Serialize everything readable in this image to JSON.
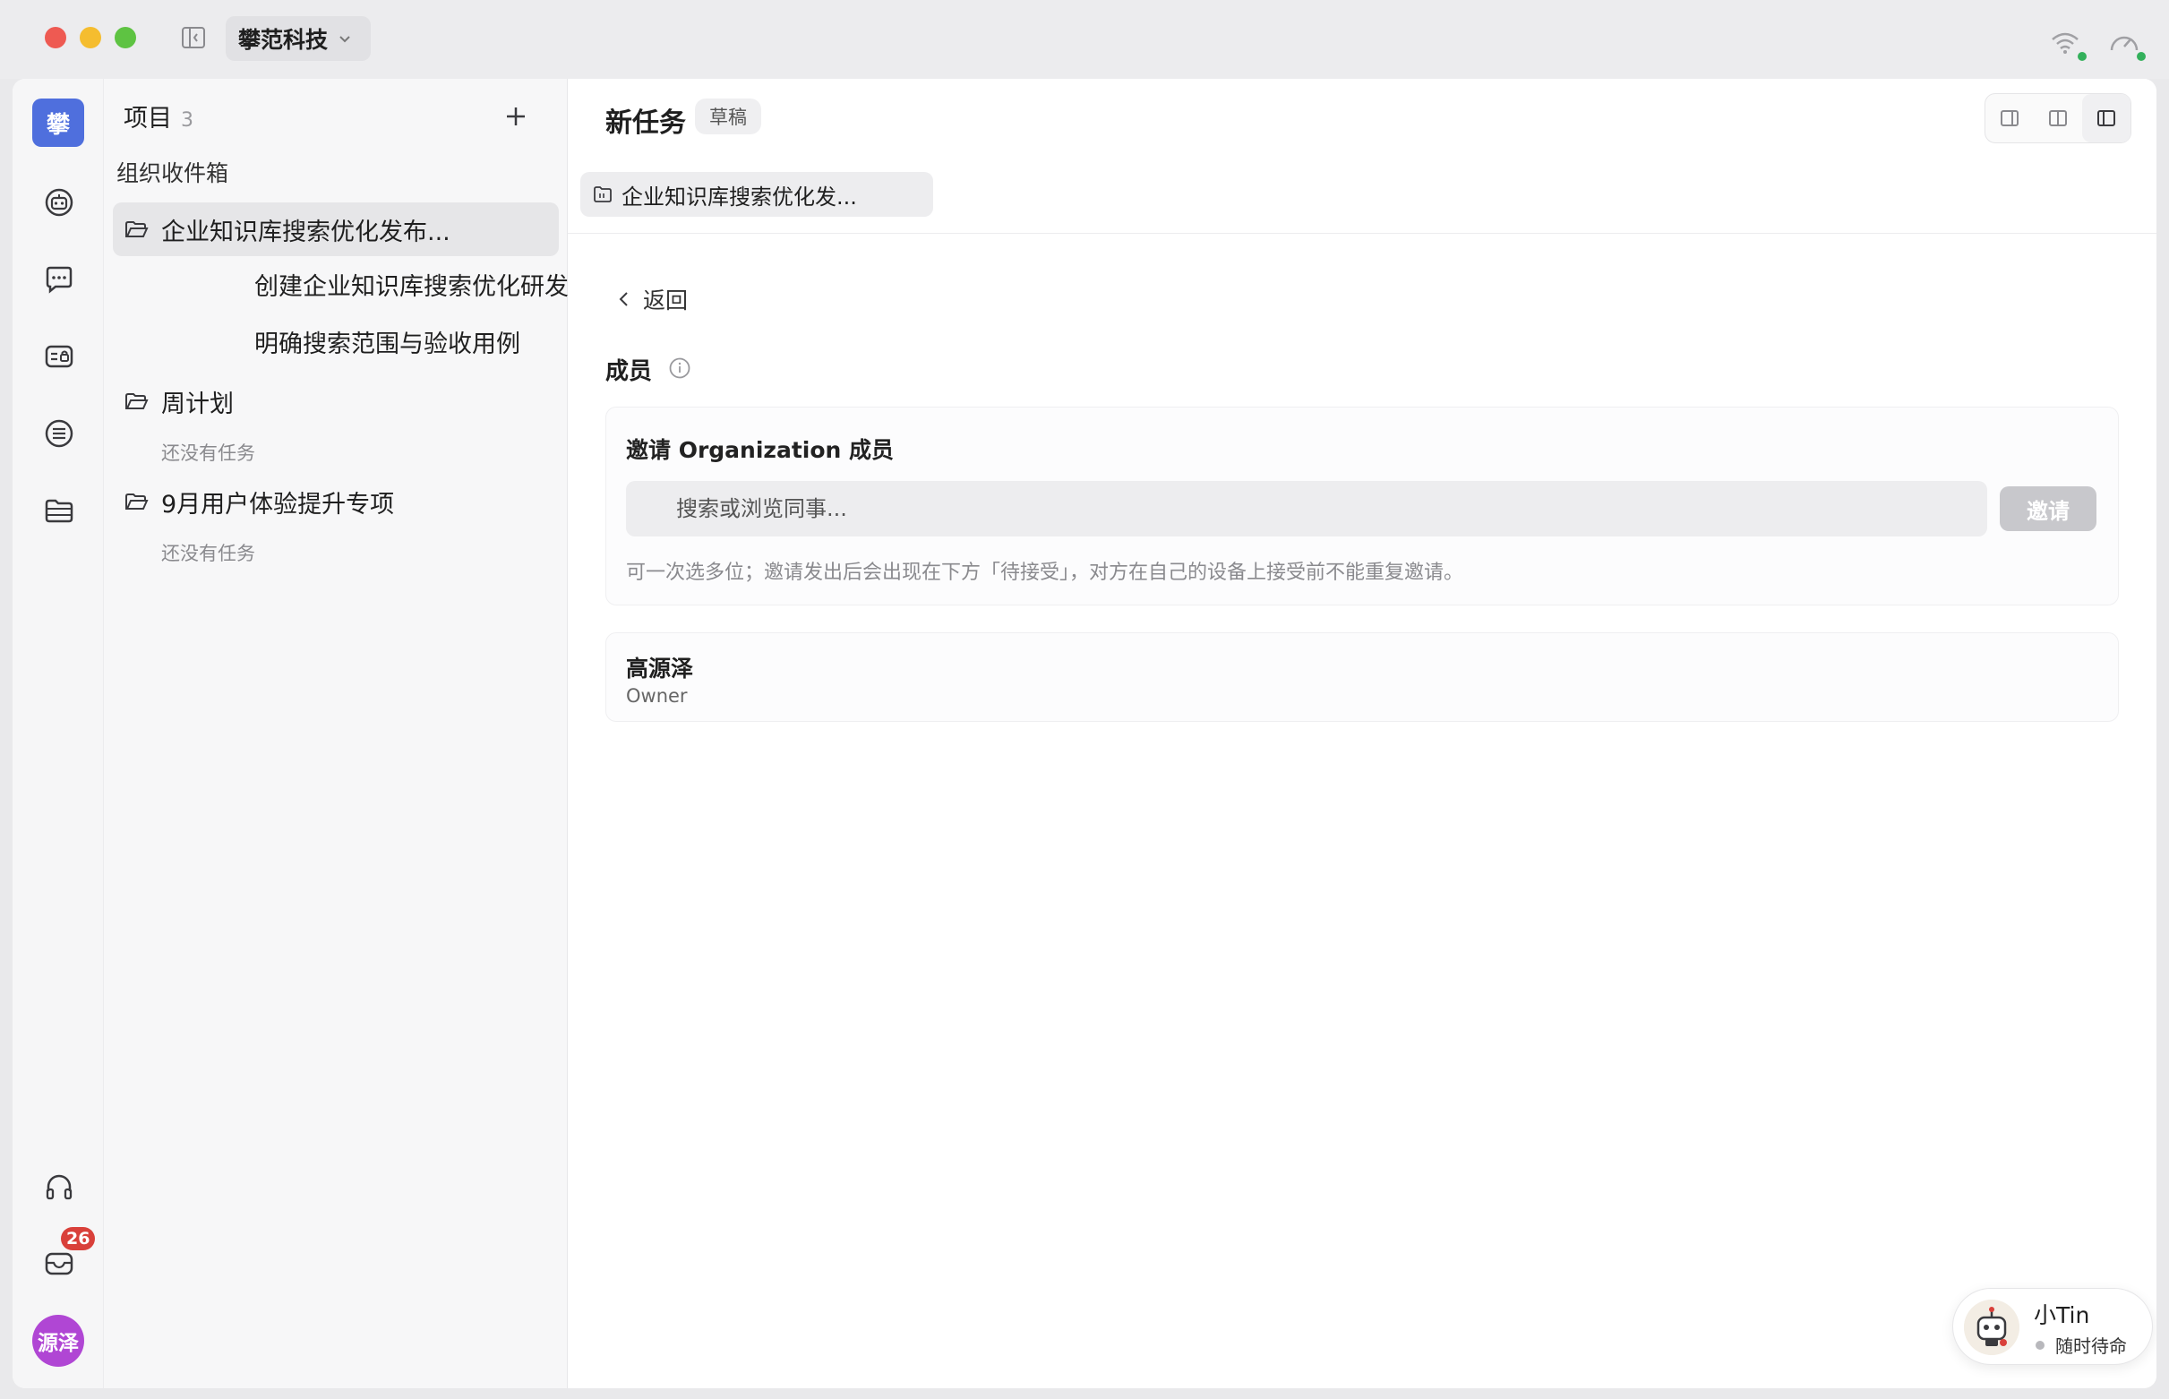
{
  "titlebar": {
    "org_name": "攀范科技"
  },
  "rail": {
    "logo_text": "攀",
    "items": [
      {
        "name": "robot-icon"
      },
      {
        "name": "chat-icon"
      },
      {
        "name": "agent-card-icon"
      },
      {
        "name": "list-icon"
      },
      {
        "name": "folder-stack-icon"
      }
    ],
    "bottom": {
      "support_icon": "headset-icon",
      "inbox_icon": "inbox-icon",
      "inbox_badge": "26",
      "avatar_text": "源泽"
    }
  },
  "panel": {
    "title": "项目",
    "count": "3",
    "inbox_label": "组织收件箱",
    "projects": [
      {
        "name": "企业知识库搜索优化发布...",
        "active": true,
        "tasks": [
          "创建企业知识库搜索优化研发事项",
          "明确搜索范围与验收用例"
        ]
      },
      {
        "name": "周计划",
        "empty_note": "还没有任务"
      },
      {
        "name": "9月用户体验提升专项",
        "empty_note": "还没有任务"
      }
    ]
  },
  "main": {
    "title": "新任务",
    "status_badge": "草稿",
    "tab_chip": "企业知识库搜索优化发...",
    "back_label": "返回",
    "members_section": "成员",
    "invite": {
      "title": "邀请 Organization 成员",
      "search_placeholder": "搜索或浏览同事...",
      "button_label": "邀请",
      "hint": "可一次选多位；邀请发出后会出现在下方「待接受」，对方在自己的设备上接受前不能重复邀请。"
    },
    "members": [
      {
        "name": "高源泽",
        "role": "Owner"
      }
    ]
  },
  "assistant": {
    "name": "小Tin",
    "status": "随时待命"
  },
  "colors": {
    "brand": "#4f6fdd",
    "badge": "#d9403a",
    "avatar": "#b046d4",
    "status_ok": "#33b05b"
  }
}
